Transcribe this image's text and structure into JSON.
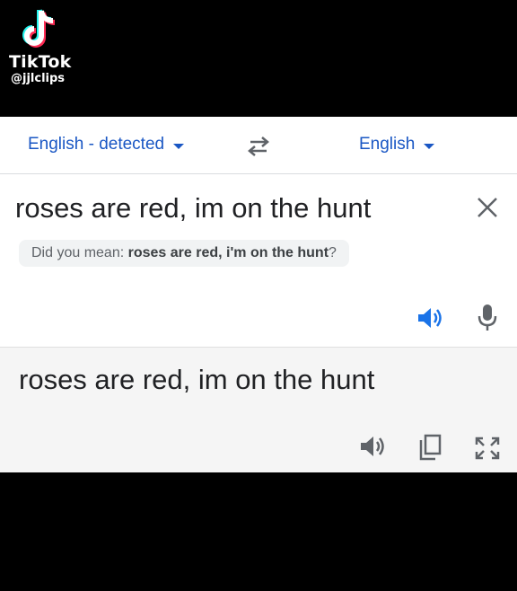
{
  "watermark": {
    "brand": "TikTok",
    "username": "@jjlclips"
  },
  "translator": {
    "source_language": "English - detected",
    "target_language": "English",
    "source_text": "roses are red, im on the hunt",
    "suggestion": {
      "prefix": "Did you mean:",
      "suggested_text": "roses are red, i'm on the hunt",
      "suffix": "?"
    },
    "translated_text": "roses are red, im on the hunt"
  },
  "icons": {
    "swap": "swap-languages-icon",
    "clear": "close-icon",
    "speak": "speaker-icon",
    "mic": "microphone-icon",
    "copy": "copy-icon",
    "fullscreen": "fullscreen-icon"
  },
  "colors": {
    "accent": "#1a57c4",
    "speaker_active": "#1a73e8",
    "icon_gray": "#5f6368",
    "target_background": "#f5f5f5"
  }
}
